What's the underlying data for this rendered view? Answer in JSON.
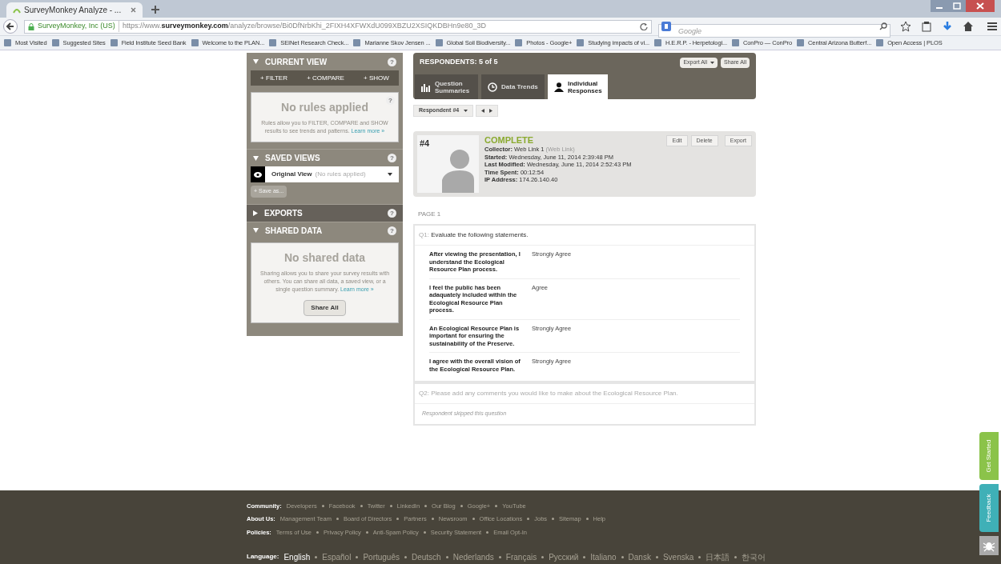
{
  "browser": {
    "tab_title": "SurveyMonkey Analyze - ...",
    "site_identity": "SurveyMonkey, Inc (US)",
    "url_prefix": "https://www.",
    "url_domain": "surveymonkey.com",
    "url_path": "/analyze/browse/Bi0DfNrbKhi_2FIXH4XFWXdU099XBZU2XSIQKDBHn9e80_3D",
    "search_placeholder": "Google",
    "bookmarks": [
      "Most Visited",
      "Suggested Sites",
      "Field Institute Seed Bank",
      "Welcome to the PLAN...",
      "SEINet Research Check...",
      "Marianne Skov Jensen ...",
      "Global Soil Biodiversity...",
      "Photos - Google+",
      "Studying impacts of vi...",
      "H.E.R.P. - Herpetologi...",
      "ConPro — ConPro",
      "Central Arizona Butterf...",
      "Open Access | PLOS"
    ]
  },
  "sidebar": {
    "sections": [
      {
        "kind": "current_view",
        "title": "CURRENT VIEW",
        "help": "?",
        "card_help": "?",
        "expanded": true,
        "actions": [
          "+ FILTER",
          "+ COMPARE",
          "+ SHOW"
        ],
        "empty_title": "No rules applied",
        "empty_text": "Rules allow you to FILTER, COMPARE and SHOW results to see trends and patterns.",
        "learn_more": "Learn more »"
      },
      {
        "kind": "saved_views",
        "title": "SAVED VIEWS",
        "help": "?",
        "expanded": true,
        "view_name": "Original View",
        "view_note": "(No rules applied)",
        "save_as": "+ Save as..."
      },
      {
        "kind": "exports",
        "title": "EXPORTS",
        "help": "?",
        "expanded": false
      },
      {
        "kind": "shared_data",
        "title": "SHARED DATA",
        "help": "?",
        "expanded": true,
        "empty_title": "No shared data",
        "empty_text": "Sharing allows you to share your survey results with others. You can share all data, a saved view, or a single question summary.",
        "learn_more": "Learn more »",
        "button": "Share All"
      }
    ]
  },
  "main": {
    "header": "RESPONDENTS: 5 of 5",
    "header_buttons": [
      {
        "label": "Export All",
        "dropdown": true
      },
      {
        "label": "Share All",
        "dropdown": false
      }
    ],
    "tabs": [
      {
        "label": "Question Summaries",
        "selected": false
      },
      {
        "label": "Data Trends",
        "selected": false
      },
      {
        "label": "Individual Responses",
        "selected": true
      }
    ],
    "respondent_select": "Respondent #4",
    "response": {
      "number": "#4",
      "status": "COMPLETE",
      "actions": [
        "Edit",
        "Delete",
        "Export"
      ],
      "details": [
        {
          "label": "Collector:",
          "value": "Web Link 1",
          "note": "(Web Link)"
        },
        {
          "label": "Started:",
          "value": "Wednesday, June 11, 2014 2:39:48 PM"
        },
        {
          "label": "Last Modified:",
          "value": "Wednesday, June 11, 2014 2:52:43 PM"
        },
        {
          "label": "Time Spent:",
          "value": "00:12:54"
        },
        {
          "label": "IP Address:",
          "value": "174.26.140.40"
        }
      ]
    },
    "page_label": "PAGE 1",
    "questions": [
      {
        "number": "Q1:",
        "text": "Evaluate the following statements.",
        "skipped": false,
        "answers": [
          {
            "statement": "After viewing the presentation, I understand the Ecological Resource Plan process.",
            "answer": "Strongly Agree"
          },
          {
            "statement": "I feel the public has been adaquately included within the Ecological Resource Plan process.",
            "answer": "Agree"
          },
          {
            "statement": "An Ecological Resource Plan is important for ensuring the sustainability of the Preserve.",
            "answer": "Strongly Agree"
          },
          {
            "statement": "I agree with the overall vision of the Ecological Resource Plan.",
            "answer": "Strongly Agree"
          }
        ]
      },
      {
        "number": "Q2:",
        "text": "Please add any comments you would like to make about the Ecological Resource Plan.",
        "skipped": true,
        "skipped_note": "Respondent skipped this question"
      }
    ]
  },
  "footer": {
    "rows": [
      {
        "label": "Community:",
        "links": [
          "Developers",
          "Facebook",
          "Twitter",
          "LinkedIn",
          "Our Blog",
          "Google+",
          "YouTube"
        ]
      },
      {
        "label": "About Us:",
        "links": [
          "Management Team",
          "Board of Directors",
          "Partners",
          "Newsroom",
          "Office Locations",
          "Jobs",
          "Sitemap",
          "Help"
        ]
      },
      {
        "label": "Policies:",
        "links": [
          "Terms of Use",
          "Privacy Policy",
          "Anti-Spam Policy",
          "Security Statement",
          "Email Opt-In"
        ]
      }
    ],
    "language": {
      "label": "Language:",
      "links": [
        "English",
        "Español",
        "Português",
        "Deutsch",
        "Nederlands",
        "Français",
        "Русский",
        "Italiano",
        "Dansk",
        "Svenska",
        "日本語",
        "한국어"
      ]
    }
  },
  "side_tabs": [
    {
      "label": "Get Started",
      "color": "#8bc34a"
    },
    {
      "label": "Feedback",
      "color": "#3fb0b7"
    }
  ]
}
